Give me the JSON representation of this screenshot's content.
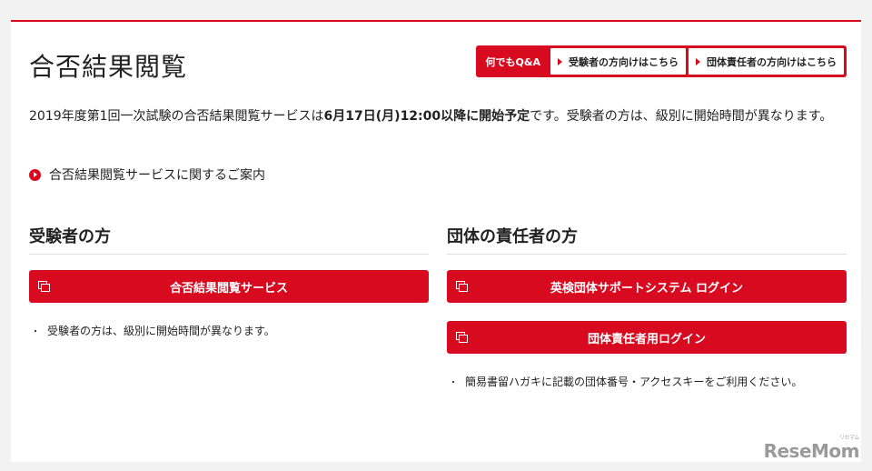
{
  "header": {
    "title": "合否結果閲覧",
    "qa_label": "何でもQ&A",
    "links": [
      "受験者の方向けはこちら",
      "団体責任者の方向けはこちら"
    ]
  },
  "intro": {
    "part1": "2019年度第1回一次試験の合否結果閲覧サービスは",
    "bold": "6月17日(月)12:00以降に開始予定",
    "part2": "です。受験者の方は、級別に開始時間が異なります。"
  },
  "guide_link": "合否結果閲覧サービスに関するご案内",
  "examinee": {
    "heading": "受験者の方",
    "button": "合否結果閲覧サービス",
    "note": "受験者の方は、級別に開始時間が異なります。"
  },
  "group": {
    "heading": "団体の責任者の方",
    "buttons": [
      "英検団体サポートシステム ログイン",
      "団体責任者用ログイン"
    ],
    "note": "簡易書留ハガキに記載の団体番号・アクセスキーをご利用ください。"
  },
  "watermark": {
    "logo": "ReseMom",
    "small": "リセマム"
  },
  "colors": {
    "accent": "#d80a1f",
    "background": "#f2f2f2"
  },
  "icons": [
    "triangle-arrow-icon",
    "circle-arrow-icon",
    "window-icon"
  ]
}
